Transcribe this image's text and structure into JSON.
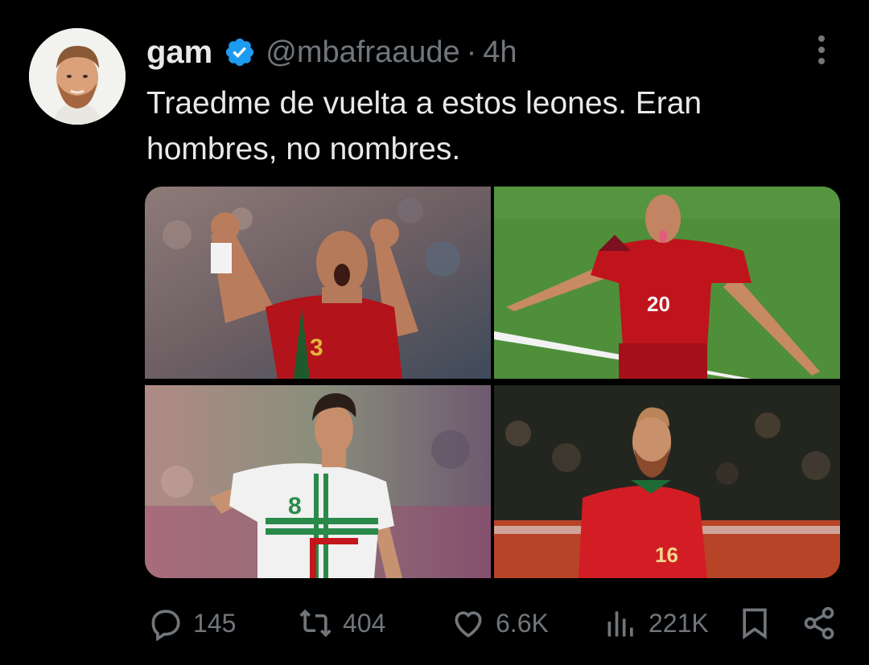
{
  "author": {
    "name": "gam",
    "handle": "@mbafraaude",
    "separator": "·",
    "time": "4h",
    "verified": true,
    "avatar_icon": "avatar-bearded-man"
  },
  "tweet": {
    "text": "Traedme de vuelta a estos leones. Eran hombres, no nombres."
  },
  "media": [
    {
      "kind": "photo",
      "jersey_number": "3",
      "kit": "red"
    },
    {
      "kind": "photo",
      "jersey_number": "20",
      "kit": "red"
    },
    {
      "kind": "photo",
      "jersey_number": "8",
      "kit": "white"
    },
    {
      "kind": "photo",
      "jersey_number": "16",
      "kit": "red"
    }
  ],
  "actions": {
    "replies": "145",
    "reposts": "404",
    "likes": "6.6K",
    "views": "221K"
  },
  "colors": {
    "background": "#000000",
    "text": "#e7e9ea",
    "muted": "#71767b",
    "verified": "#1d9bf0",
    "portugal_red": "#c4161c",
    "pitch_green": "#4f8f3a"
  },
  "icons": [
    "reply-icon",
    "repost-icon",
    "like-icon",
    "views-icon",
    "bookmark-icon",
    "share-icon",
    "more-icon",
    "verified-badge-icon"
  ]
}
